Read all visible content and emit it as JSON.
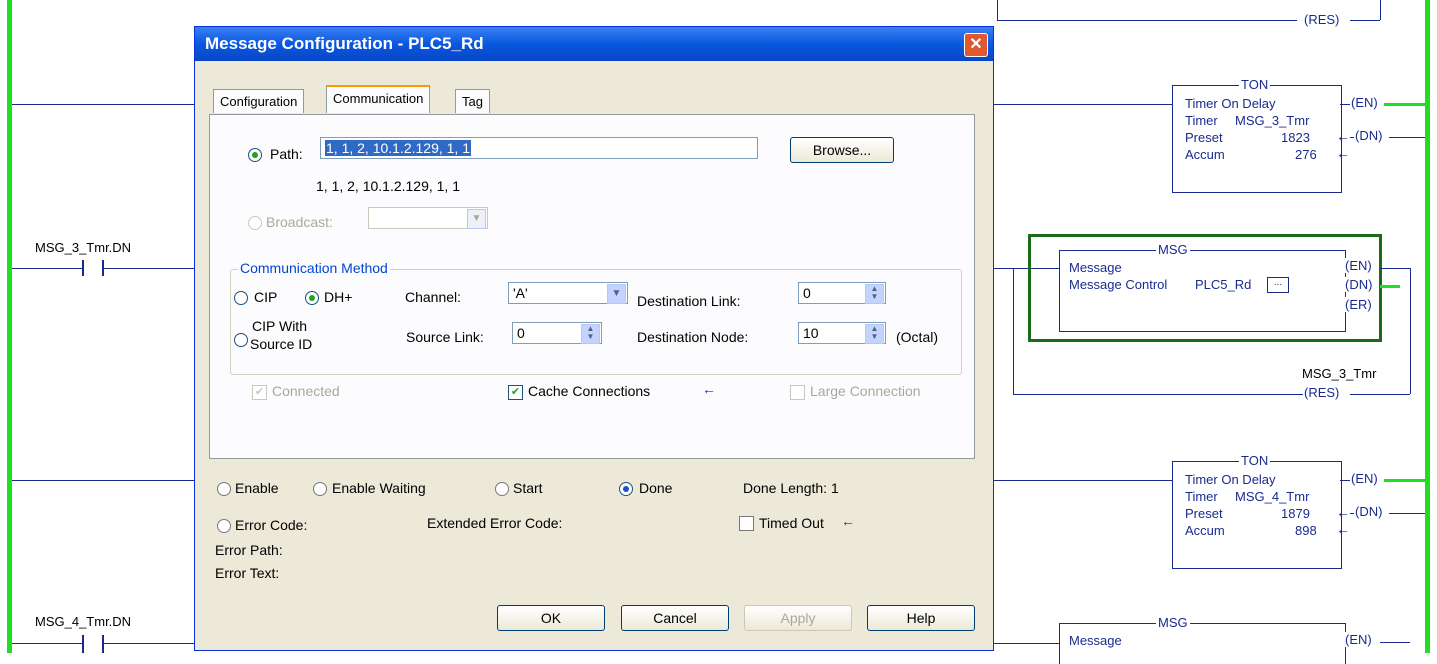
{
  "ladder": {
    "contact1": "MSG_3_Tmr.DN",
    "contact2": "MSG_4_Tmr.DN",
    "res_coil": "(RES)",
    "ton1": {
      "header": "TON",
      "title": "Timer On Delay",
      "timer_label": "Timer",
      "timer": "MSG_3_Tmr",
      "preset_label": "Preset",
      "preset": "1823",
      "accum_label": "Accum",
      "accum": "276",
      "en": "(EN)",
      "dn": "(DN)"
    },
    "msg1": {
      "header": "MSG",
      "title": "Message",
      "control_label": "Message Control",
      "control": "PLC5_Rd",
      "dots": "...",
      "en": "(EN)",
      "dn": "(DN)",
      "er": "(ER)"
    },
    "res_tag": "MSG_3_Tmr",
    "ton2": {
      "header": "TON",
      "title": "Timer On Delay",
      "timer_label": "Timer",
      "timer": "MSG_4_Tmr",
      "preset_label": "Preset",
      "preset": "1879",
      "accum_label": "Accum",
      "accum": "898",
      "en": "(EN)",
      "dn": "(DN)"
    },
    "msg2": {
      "header": "MSG",
      "title": "Message",
      "en": "(EN)"
    }
  },
  "dialog": {
    "title": "Message Configuration - PLC5_Rd",
    "close": "✕",
    "tabs": [
      "Configuration",
      "Communication",
      "Tag"
    ],
    "path_label": "Path:",
    "path_value": "1, 1, 2, 10.1.2.129, 1, 1",
    "path_resolved": "1, 1, 2, 10.1.2.129, 1, 1",
    "browse": "Browse...",
    "broadcast_label": "Broadcast:",
    "comm_method": "Communication Method",
    "cip": "CIP",
    "dhplus": "DH+",
    "channel_label": "Channel:",
    "channel_value": "'A'",
    "dest_link_label": "Destination Link:",
    "dest_link_value": "0",
    "cip_with": "CIP With",
    "source_id": "Source ID",
    "source_link_label": "Source Link:",
    "source_link_value": "0",
    "dest_node_label": "Destination Node:",
    "dest_node_value": "10",
    "octal": "(Octal)",
    "connected": "Connected",
    "cache": "Cache Connections",
    "large": "Large Connection",
    "status": {
      "enable": "Enable",
      "enable_waiting": "Enable Waiting",
      "start": "Start",
      "done": "Done",
      "done_length": "Done Length: 1",
      "error_code": "Error Code:",
      "ext_error": "Extended Error Code:",
      "timed_out": "Timed Out",
      "error_path": "Error Path:",
      "error_text": "Error Text:"
    },
    "buttons": {
      "ok": "OK",
      "cancel": "Cancel",
      "apply": "Apply",
      "help": "Help"
    }
  }
}
